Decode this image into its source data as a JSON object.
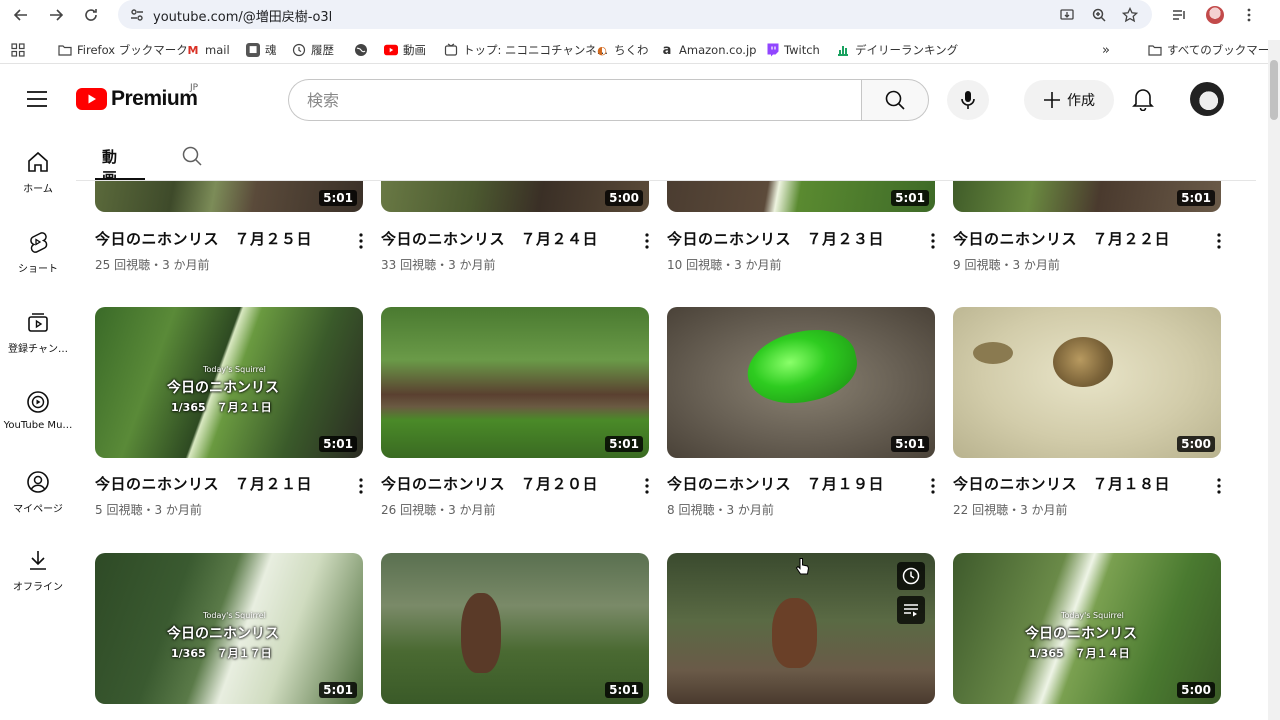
{
  "browser": {
    "url": "youtube.com/@増田戻樹-o3l",
    "bookmarks": [
      {
        "label": "Firefox ブックマーク",
        "icon": "folder-icon"
      },
      {
        "label": "mail",
        "icon": "gmail-icon"
      },
      {
        "label": "魂",
        "icon": "app-icon"
      },
      {
        "label": "履歴",
        "icon": "history-icon"
      },
      {
        "label": "",
        "icon": "globe-icon"
      },
      {
        "label": "動画",
        "icon": "youtube-icon"
      },
      {
        "label": "トップ: ニコニコチャンネ…",
        "icon": "niconico-icon"
      },
      {
        "label": "ちくわ",
        "icon": "chikuwa-icon"
      },
      {
        "label": "Amazon.co.jp",
        "icon": "amazon-icon"
      },
      {
        "label": "Twitch",
        "icon": "twitch-icon"
      },
      {
        "label": "デイリーランキング",
        "icon": "ranking-icon"
      }
    ],
    "all_bookmarks": "すべてのブックマーク"
  },
  "header": {
    "logo_text": "Premium",
    "logo_region": "JP",
    "search_placeholder": "検索",
    "create_label": "作成"
  },
  "sidenav": [
    {
      "label": "ホーム",
      "icon": "home-icon"
    },
    {
      "label": "ショート",
      "icon": "shorts-icon"
    },
    {
      "label": "登録チャン…",
      "icon": "subscriptions-icon"
    },
    {
      "label": "YouTube Mu…",
      "icon": "youtube-music-icon"
    },
    {
      "label": "マイページ",
      "icon": "profile-icon"
    },
    {
      "label": "オフライン",
      "icon": "download-icon"
    }
  ],
  "tabs": {
    "videos": "動画"
  },
  "videos": [
    {
      "title": "今日のニホンリス　７月２５日",
      "meta": "25 回視聴・3 か月前",
      "duration": "5:01"
    },
    {
      "title": "今日のニホンリス　７月２４日",
      "meta": "33 回視聴・3 か月前",
      "duration": "5:00"
    },
    {
      "title": "今日のニホンリス　７月２３日",
      "meta": "10 回視聴・3 か月前",
      "duration": "5:01"
    },
    {
      "title": "今日のニホンリス　７月２２日",
      "meta": "9 回視聴・3 か月前",
      "duration": "5:01"
    },
    {
      "title": "今日のニホンリス　７月２１日",
      "meta": "5 回視聴・3 か月前",
      "duration": "5:01",
      "overlay_title": "今日のニホンリス",
      "overlay_date": "1/365　７月２１日",
      "overlay_sub": "Today's Squirrel"
    },
    {
      "title": "今日のニホンリス　７月２０日",
      "meta": "26 回視聴・3 か月前",
      "duration": "5:01"
    },
    {
      "title": "今日のニホンリス　７月１９日",
      "meta": "8 回視聴・3 か月前",
      "duration": "5:01"
    },
    {
      "title": "今日のニホンリス　７月１８日",
      "meta": "22 回視聴・3 か月前",
      "duration": "5:00"
    },
    {
      "title": "",
      "meta": "",
      "duration": "5:01",
      "overlay_title": "今日のニホンリス",
      "overlay_date": "1/365　７月１７日",
      "overlay_sub": "Today's Squirrel"
    },
    {
      "title": "",
      "meta": "",
      "duration": "5:01"
    },
    {
      "title": "",
      "meta": "",
      "duration": ""
    },
    {
      "title": "",
      "meta": "",
      "duration": "5:00",
      "overlay_title": "今日のニホンリス",
      "overlay_date": "1/365　７月１４日",
      "overlay_sub": "Today's Squirrel"
    }
  ]
}
